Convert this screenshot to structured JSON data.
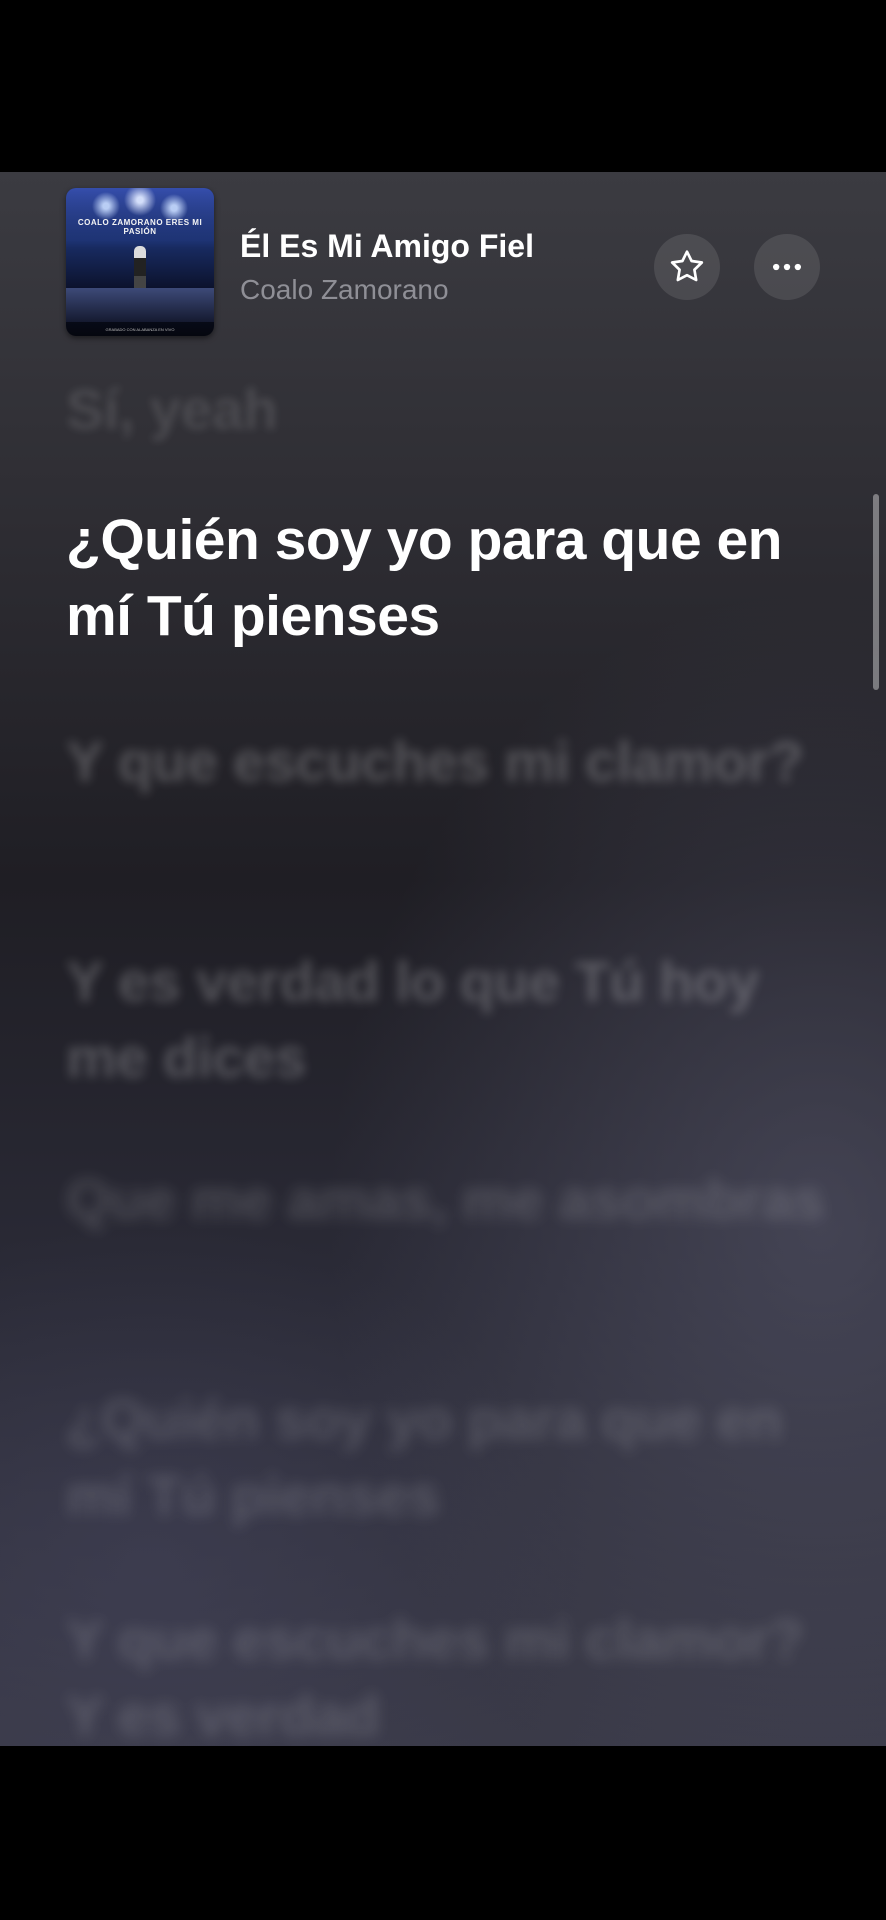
{
  "now_playing": {
    "title": "Él Es Mi Amigo Fiel",
    "artist": "Coalo Zamorano",
    "album_art": {
      "text": "COALO ZAMORANO  ERES MI PASIÓN",
      "subtitle": "EN VIVO",
      "footer": "GRABADO CON ALABANZA EN VIVO"
    }
  },
  "actions": {
    "favorite_icon": "star-outline-icon",
    "more_icon": "ellipsis-icon"
  },
  "lyrics": {
    "previous": "Sí, yeah",
    "current": "¿Quién soy yo para que en mí Tú pienses",
    "upcoming": [
      "Y que escuches mi clamor?",
      "Y es verdad lo que Tú hoy me dices",
      "Que me amas, me asombras",
      "¿Quién soy yo para que en mí Tú pienses",
      "Y que escuches mi clamor? Y es verdad"
    ]
  },
  "colors": {
    "background_top": "#3b3b41",
    "background_bottom": "#3a3a48",
    "active_lyric": "#ffffff",
    "artist_text": "#8f8f96"
  }
}
